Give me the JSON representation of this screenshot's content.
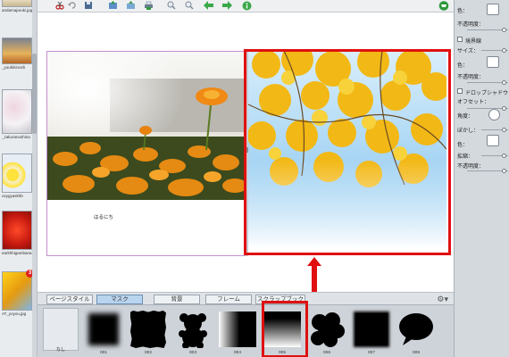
{
  "left_strip": {
    "thumbnails": [
      {
        "caption": "andamajaruki.jpg",
        "badge": ""
      },
      {
        "caption": "_youhikinosh",
        "badge": ""
      },
      {
        "caption": "_zakuranoshina",
        "badge": ""
      },
      {
        "caption": "oxygyaskhb",
        "badge": ""
      },
      {
        "caption": "earkhhigambana.jpg",
        "badge": ""
      },
      {
        "caption": "AT_yoyou.jpg",
        "badge": "3"
      }
    ]
  },
  "toolbar": {
    "icons": [
      "cut-icon",
      "undo-icon",
      "save-icon",
      "import-icon",
      "export-icon",
      "print-icon",
      "zoom-in-icon",
      "zoom-out-icon",
      "arrow-left-icon",
      "arrow-right-icon",
      "info-icon",
      "cart-icon"
    ]
  },
  "canvas": {
    "left_page": {
      "caption": "はるにち"
    },
    "right_page": {
      "mask_applied": "005"
    }
  },
  "tabs": {
    "items": [
      {
        "label": "ページスタイル",
        "active": false
      },
      {
        "label": "マスク",
        "active": true
      },
      {
        "label": "背景",
        "active": false
      },
      {
        "label": "フレーム",
        "active": false
      },
      {
        "label": "スクラップブック",
        "active": false
      }
    ]
  },
  "mask_strip": {
    "none_label": "なし",
    "items": [
      {
        "label": "001",
        "shape": "soft-square"
      },
      {
        "label": "002",
        "shape": "rough-square"
      },
      {
        "label": "003",
        "shape": "bear"
      },
      {
        "label": "004",
        "shape": "gradient-left"
      },
      {
        "label": "005",
        "shape": "gradient-down",
        "selected": true
      },
      {
        "label": "006",
        "shape": "cloud"
      },
      {
        "label": "007",
        "shape": "soft-square"
      },
      {
        "label": "008",
        "shape": "speech-bubble"
      }
    ]
  },
  "properties": {
    "color_label": "色：",
    "opacity_label": "不透明度：",
    "border_label": "境界線",
    "size_label": "サイズ：",
    "border_color_label": "色：",
    "border_opacity_label": "不透明度：",
    "shadow_label": "ドロップシャドウ",
    "offset_label": "オフセット：",
    "angle_label": "角度：",
    "blur_label": "ぼかし：",
    "shadow_color_label": "色：",
    "scale_label": "拡縮：",
    "shadow_opacity_label": "不透明度："
  }
}
